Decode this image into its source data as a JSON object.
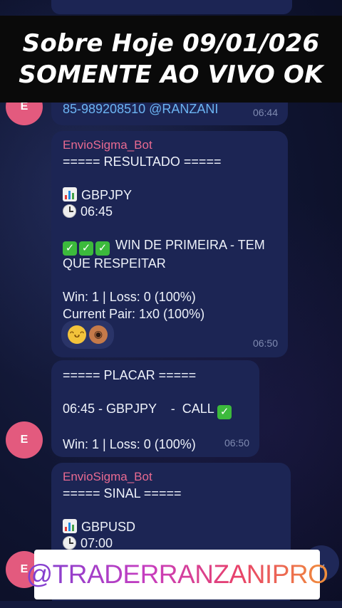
{
  "banner": {
    "line1": "Sobre Hoje 09/01/026",
    "line2": "SOMENTE AO VIVO OK"
  },
  "top_message": {
    "avatar_initial": "E",
    "text": "85-989208510 @RANZANI",
    "time": "06:44"
  },
  "result_message": {
    "sender": "EnvioSigma_Bot",
    "header": "===== RESULTADO =====",
    "pair": "GBPJPY",
    "clock": "06:45",
    "win_text": "WIN DE PRIMEIRA - TEM",
    "win_text_2": "QUE RESPEITAR",
    "score": "Win: 1 | Loss: 0 (100%)",
    "current_pair": "Current Pair: 1x0 (100%)",
    "reactions": [
      "grinning-face",
      "face-avatar"
    ],
    "time": "06:50"
  },
  "placar_message": {
    "header": "===== PLACAR =====",
    "entry": "06:45 - GBPJPY    -  CALL",
    "score": "Win: 1 | Loss: 0 (100%)",
    "time": "06:50",
    "avatar_initial": "E"
  },
  "signal_message": {
    "sender": "EnvioSigma_Bot",
    "header": "===== SINAL =====",
    "pair": "GBPUSD",
    "clock": "07:00",
    "avatar_initial": "E"
  },
  "watermark": {
    "text": "@TRADERRANZANIPRO"
  },
  "colors": {
    "bubble": "#1c2554",
    "sender": "#e86a91",
    "link": "#6cb4f2",
    "avatar": "#e35a7e",
    "check": "#3cba3c"
  }
}
